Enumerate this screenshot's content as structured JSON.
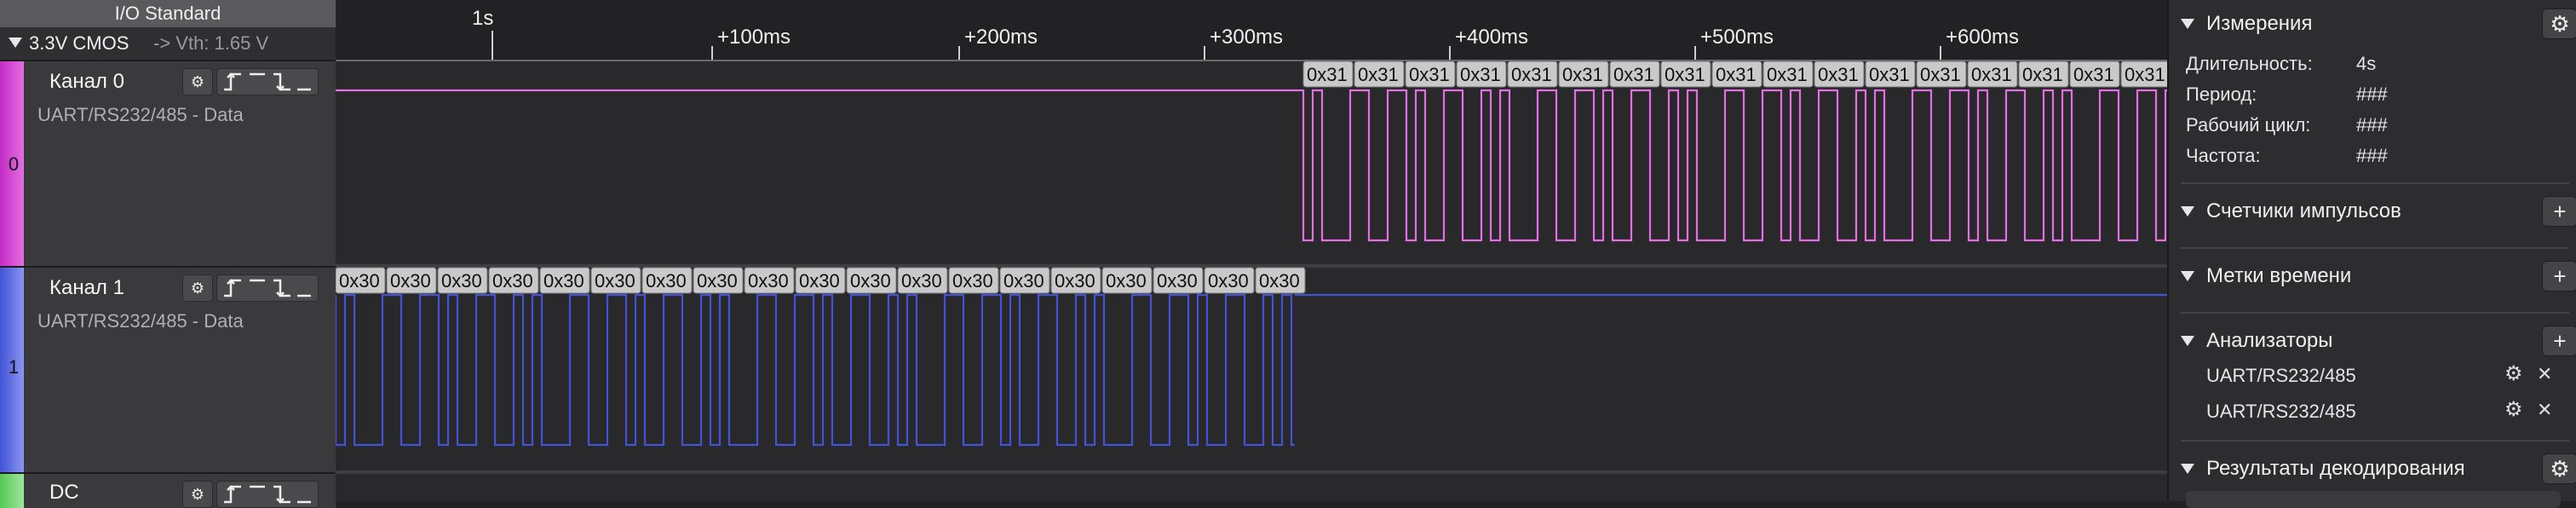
{
  "io": {
    "title": "I/O Standard",
    "voltage": "3.3V CMOS",
    "vth": "-> Vth: 1.65 V"
  },
  "channels": [
    {
      "index": "0",
      "name": "Канал 0",
      "protocol": "UART/RS232/485 - Data",
      "color": "#c42bc4",
      "color_light": "#e36fe3"
    },
    {
      "index": "1",
      "name": "Канал 1",
      "protocol": "UART/RS232/485 - Data",
      "color": "#4253d6",
      "color_light": "#8a96f0"
    },
    {
      "index": "",
      "name": "DC",
      "protocol": "",
      "color": "#55c855",
      "color_light": "#9ee69e"
    }
  ],
  "ruler": {
    "labels": [
      "1s",
      "+100ms",
      "+200ms",
      "+300ms",
      "+400ms",
      "+500ms",
      "+600ms"
    ]
  },
  "decode": {
    "ch0_byte": "0x31",
    "ch1_byte": "0x30"
  },
  "side": {
    "measurements_title": "Измерения",
    "measurements": [
      {
        "key": "Длительность:",
        "value": "4s"
      },
      {
        "key": "Период:",
        "value": "###"
      },
      {
        "key": "Рабочий цикл:",
        "value": "###"
      },
      {
        "key": "Частота:",
        "value": "###"
      }
    ],
    "pulse_counters_title": "Счетчики импульсов",
    "timestamps_title": "Метки времени",
    "analyzers_title": "Анализаторы",
    "analyzers": [
      "UART/RS232/485",
      "UART/RS232/485"
    ],
    "decode_results_title": "Результаты декодирования"
  },
  "icons": {
    "gear": "⚙",
    "plus": "+",
    "close": "✕"
  }
}
